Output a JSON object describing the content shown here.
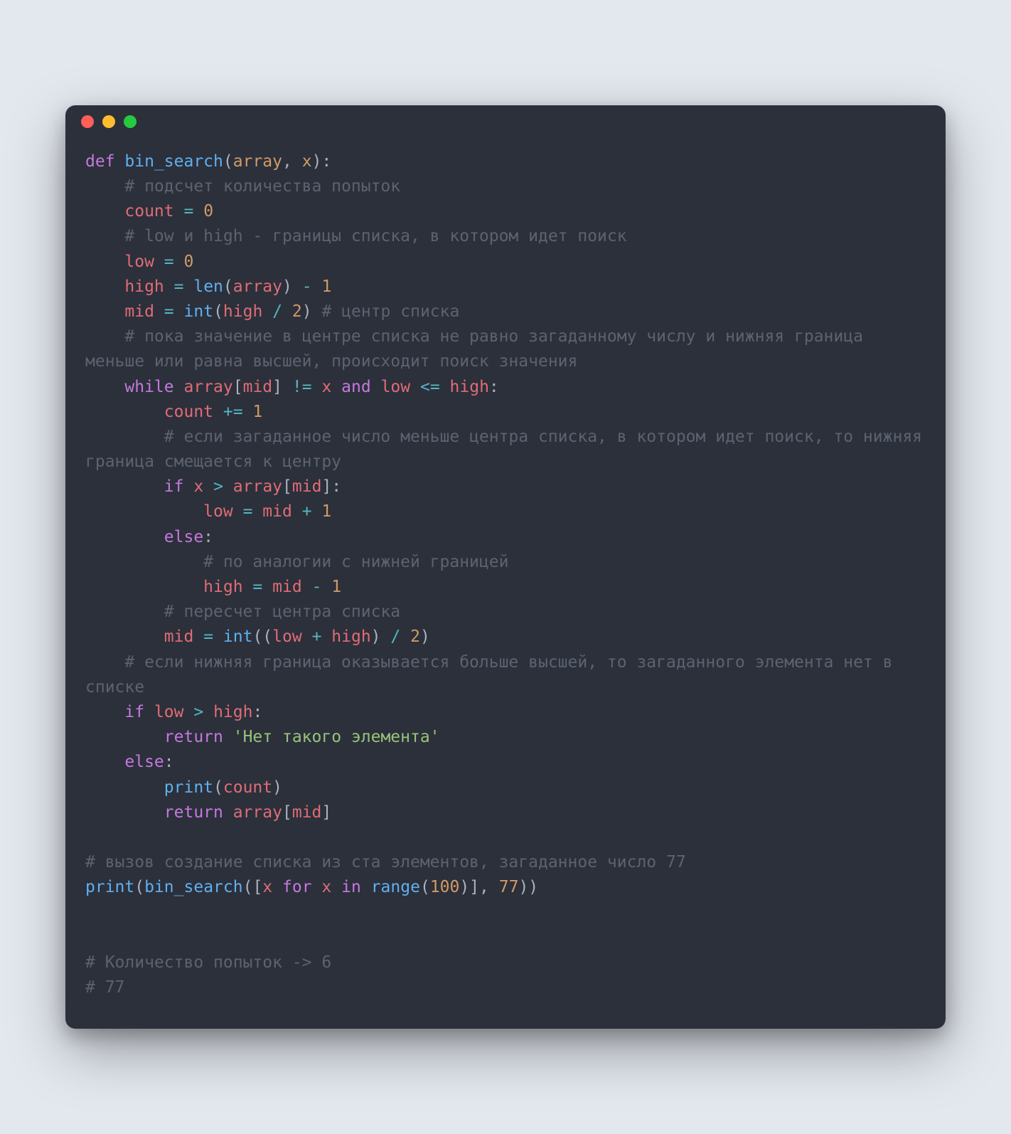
{
  "window": {
    "traffic_lights": [
      "red",
      "yellow",
      "green"
    ]
  },
  "colors": {
    "background_page": "#E3E8EF",
    "background_window": "#2B303B",
    "keyword": "#C678DD",
    "function": "#61AFEF",
    "param": "#D19A66",
    "punct": "#ABB2BF",
    "ident": "#E06C75",
    "operator": "#56B6C2",
    "number": "#D19A66",
    "string": "#98C379",
    "comment": "#5C6370",
    "plain": "#C0C5CE"
  },
  "code": {
    "language": "python",
    "tokens": [
      [
        [
          "kw",
          "def"
        ],
        [
          "plain",
          " "
        ],
        [
          "fn",
          "bin_search"
        ],
        [
          "punct",
          "("
        ],
        [
          "param",
          "array"
        ],
        [
          "punct",
          ", "
        ],
        [
          "param",
          "x"
        ],
        [
          "punct",
          "):"
        ]
      ],
      [
        [
          "plain",
          "    "
        ],
        [
          "cmt",
          "# подсчет количества попыток"
        ]
      ],
      [
        [
          "plain",
          "    "
        ],
        [
          "id",
          "count"
        ],
        [
          "plain",
          " "
        ],
        [
          "op",
          "="
        ],
        [
          "plain",
          " "
        ],
        [
          "num",
          "0"
        ]
      ],
      [
        [
          "plain",
          "    "
        ],
        [
          "cmt",
          "# low и high - границы списка, в котором идет поиск"
        ]
      ],
      [
        [
          "plain",
          "    "
        ],
        [
          "id",
          "low"
        ],
        [
          "plain",
          " "
        ],
        [
          "op",
          "="
        ],
        [
          "plain",
          " "
        ],
        [
          "num",
          "0"
        ]
      ],
      [
        [
          "plain",
          "    "
        ],
        [
          "id",
          "high"
        ],
        [
          "plain",
          " "
        ],
        [
          "op",
          "="
        ],
        [
          "plain",
          " "
        ],
        [
          "fn",
          "len"
        ],
        [
          "punct",
          "("
        ],
        [
          "id",
          "array"
        ],
        [
          "punct",
          ")"
        ],
        [
          "plain",
          " "
        ],
        [
          "op",
          "-"
        ],
        [
          "plain",
          " "
        ],
        [
          "num",
          "1"
        ]
      ],
      [
        [
          "plain",
          "    "
        ],
        [
          "id",
          "mid"
        ],
        [
          "plain",
          " "
        ],
        [
          "op",
          "="
        ],
        [
          "plain",
          " "
        ],
        [
          "fn",
          "int"
        ],
        [
          "punct",
          "("
        ],
        [
          "id",
          "high"
        ],
        [
          "plain",
          " "
        ],
        [
          "op",
          "/"
        ],
        [
          "plain",
          " "
        ],
        [
          "num",
          "2"
        ],
        [
          "punct",
          ")"
        ],
        [
          "plain",
          " "
        ],
        [
          "cmt",
          "# центр списка"
        ]
      ],
      [
        [
          "plain",
          "    "
        ],
        [
          "cmt",
          "# пока значение в центре списка не равно загаданному числу и нижняя граница меньше или равна высшей, происходит поиск значения"
        ]
      ],
      [
        [
          "plain",
          "    "
        ],
        [
          "kw",
          "while"
        ],
        [
          "plain",
          " "
        ],
        [
          "id",
          "array"
        ],
        [
          "punct",
          "["
        ],
        [
          "id",
          "mid"
        ],
        [
          "punct",
          "]"
        ],
        [
          "plain",
          " "
        ],
        [
          "op",
          "!="
        ],
        [
          "plain",
          " "
        ],
        [
          "id",
          "x"
        ],
        [
          "plain",
          " "
        ],
        [
          "kw",
          "and"
        ],
        [
          "plain",
          " "
        ],
        [
          "id",
          "low"
        ],
        [
          "plain",
          " "
        ],
        [
          "op",
          "<="
        ],
        [
          "plain",
          " "
        ],
        [
          "id",
          "high"
        ],
        [
          "punct",
          ":"
        ]
      ],
      [
        [
          "plain",
          "        "
        ],
        [
          "id",
          "count"
        ],
        [
          "plain",
          " "
        ],
        [
          "op",
          "+="
        ],
        [
          "plain",
          " "
        ],
        [
          "num",
          "1"
        ]
      ],
      [
        [
          "plain",
          "        "
        ],
        [
          "cmt",
          "# если загаданное число меньше центра списка, в котором идет поиск, то нижняя граница смещается к центру"
        ]
      ],
      [
        [
          "plain",
          "        "
        ],
        [
          "kw",
          "if"
        ],
        [
          "plain",
          " "
        ],
        [
          "id",
          "x"
        ],
        [
          "plain",
          " "
        ],
        [
          "op",
          ">"
        ],
        [
          "plain",
          " "
        ],
        [
          "id",
          "array"
        ],
        [
          "punct",
          "["
        ],
        [
          "id",
          "mid"
        ],
        [
          "punct",
          "]:"
        ]
      ],
      [
        [
          "plain",
          "            "
        ],
        [
          "id",
          "low"
        ],
        [
          "plain",
          " "
        ],
        [
          "op",
          "="
        ],
        [
          "plain",
          " "
        ],
        [
          "id",
          "mid"
        ],
        [
          "plain",
          " "
        ],
        [
          "op",
          "+"
        ],
        [
          "plain",
          " "
        ],
        [
          "num",
          "1"
        ]
      ],
      [
        [
          "plain",
          "        "
        ],
        [
          "kw",
          "else"
        ],
        [
          "punct",
          ":"
        ]
      ],
      [
        [
          "plain",
          "            "
        ],
        [
          "cmt",
          "# по аналогии с нижней границей"
        ]
      ],
      [
        [
          "plain",
          "            "
        ],
        [
          "id",
          "high"
        ],
        [
          "plain",
          " "
        ],
        [
          "op",
          "="
        ],
        [
          "plain",
          " "
        ],
        [
          "id",
          "mid"
        ],
        [
          "plain",
          " "
        ],
        [
          "op",
          "-"
        ],
        [
          "plain",
          " "
        ],
        [
          "num",
          "1"
        ]
      ],
      [
        [
          "plain",
          "        "
        ],
        [
          "cmt",
          "# пересчет центра списка"
        ]
      ],
      [
        [
          "plain",
          "        "
        ],
        [
          "id",
          "mid"
        ],
        [
          "plain",
          " "
        ],
        [
          "op",
          "="
        ],
        [
          "plain",
          " "
        ],
        [
          "fn",
          "int"
        ],
        [
          "punct",
          "(("
        ],
        [
          "id",
          "low"
        ],
        [
          "plain",
          " "
        ],
        [
          "op",
          "+"
        ],
        [
          "plain",
          " "
        ],
        [
          "id",
          "high"
        ],
        [
          "punct",
          ")"
        ],
        [
          "plain",
          " "
        ],
        [
          "op",
          "/"
        ],
        [
          "plain",
          " "
        ],
        [
          "num",
          "2"
        ],
        [
          "punct",
          ")"
        ]
      ],
      [
        [
          "plain",
          "    "
        ],
        [
          "cmt",
          "# если нижняя граница оказывается больше высшей, то загаданного элемента нет в списке"
        ]
      ],
      [
        [
          "plain",
          "    "
        ],
        [
          "kw",
          "if"
        ],
        [
          "plain",
          " "
        ],
        [
          "id",
          "low"
        ],
        [
          "plain",
          " "
        ],
        [
          "op",
          ">"
        ],
        [
          "plain",
          " "
        ],
        [
          "id",
          "high"
        ],
        [
          "punct",
          ":"
        ]
      ],
      [
        [
          "plain",
          "        "
        ],
        [
          "kw",
          "return"
        ],
        [
          "plain",
          " "
        ],
        [
          "str",
          "'Нет такого элемента'"
        ]
      ],
      [
        [
          "plain",
          "    "
        ],
        [
          "kw",
          "else"
        ],
        [
          "punct",
          ":"
        ]
      ],
      [
        [
          "plain",
          "        "
        ],
        [
          "fn",
          "print"
        ],
        [
          "punct",
          "("
        ],
        [
          "id",
          "count"
        ],
        [
          "punct",
          ")"
        ]
      ],
      [
        [
          "plain",
          "        "
        ],
        [
          "kw",
          "return"
        ],
        [
          "plain",
          " "
        ],
        [
          "id",
          "array"
        ],
        [
          "punct",
          "["
        ],
        [
          "id",
          "mid"
        ],
        [
          "punct",
          "]"
        ]
      ],
      [
        [
          "plain",
          ""
        ]
      ],
      [
        [
          "cmt",
          "# вызов создание списка из ста элементов, загаданное число 77"
        ]
      ],
      [
        [
          "fn",
          "print"
        ],
        [
          "punct",
          "("
        ],
        [
          "fn",
          "bin_search"
        ],
        [
          "punct",
          "(["
        ],
        [
          "id",
          "x"
        ],
        [
          "plain",
          " "
        ],
        [
          "kw",
          "for"
        ],
        [
          "plain",
          " "
        ],
        [
          "id",
          "x"
        ],
        [
          "plain",
          " "
        ],
        [
          "kw",
          "in"
        ],
        [
          "plain",
          " "
        ],
        [
          "fn",
          "range"
        ],
        [
          "punct",
          "("
        ],
        [
          "num",
          "100"
        ],
        [
          "punct",
          ")], "
        ],
        [
          "num",
          "77"
        ],
        [
          "punct",
          "))"
        ]
      ],
      [
        [
          "plain",
          ""
        ]
      ],
      [
        [
          "plain",
          ""
        ]
      ],
      [
        [
          "cmt",
          "# Количество попыток -> 6"
        ]
      ],
      [
        [
          "cmt",
          "# 77"
        ]
      ]
    ]
  }
}
